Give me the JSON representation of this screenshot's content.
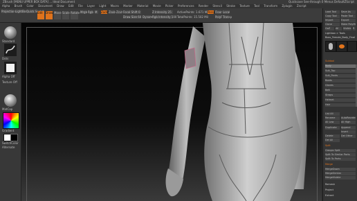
{
  "title_bar": {
    "text": "ZBrush  [MENU UPPER BOX DATA] ... Ideal Document",
    "right": "Quicksave   See-through 0   Menus   DefaultZScript"
  },
  "menu": [
    "Alpha",
    "Brush",
    "Color",
    "Document",
    "Draw",
    "Edit",
    "File",
    "Layer",
    "Light",
    "Macro",
    "Marker",
    "Material",
    "Movie",
    "Picker",
    "Preferences",
    "Render",
    "Stencil",
    "Stroke",
    "Texture",
    "Tool",
    "Transform",
    "Zplugin",
    "Zscript"
  ],
  "shelf": {
    "projection_master": "Projection Master",
    "lightbox": "LightBox",
    "quick_sketch": "Quick Sketch",
    "edit": "Edit",
    "draw": "Draw",
    "move": "Move",
    "scale": "Scale",
    "rotate": "Rotate",
    "mrgb": "Mrgb",
    "rgb": "Rgb",
    "m": "M",
    "zadd": "Zadd",
    "zsub": "Zsub",
    "zcut": "Zcut",
    "focal_shift": "Focal Shift 0",
    "draw_size": "Draw Size 64",
    "dynamic": "Dynamic",
    "z_intensity": "Z Intensity 25",
    "rgb_intensity": "Rgb Intensity 100",
    "active_points": "ActivePoints: 1.671 Mil",
    "total_points": "TotalPoints: 15.502 Mil",
    "persp": "Persp",
    "floor": "Floor",
    "polyframe": "PolyF",
    "local": "Local",
    "transp": "Transp"
  },
  "left_shelf": {
    "brush": "Standard",
    "stroke": "Dots",
    "alpha": "Alpha Off",
    "texture": "Texture Off",
    "material": "MatCap",
    "gradient": "Gradient",
    "switch_color": "SwitchColor",
    "alternate": "Alternate"
  },
  "right_tray": {
    "header": [
      "Load Tool",
      "Save As",
      "Copy Tool",
      "Paste Tool",
      "Import",
      "Export",
      "Clone",
      "Make PolyMesh3D",
      "GoZ",
      "All",
      "Visible",
      "R"
    ],
    "lightbox_tools": "Lightbox > Tools",
    "tool_name": "Boss_Female_Body_Final",
    "subtool": "Subtool",
    "subtools": [
      "Body",
      "Suit_Top",
      "Suit_Pants",
      "Boots",
      "Gloves",
      "Belt",
      "Straps",
      "Helmet",
      "Hair"
    ],
    "list_all": "List All",
    "rename": "Rename",
    "auto_reorder": "AutoReorder",
    "all_low": "All Low",
    "all_high": "All High",
    "duplicate": "Duplicate",
    "append": "Append",
    "insert": "Insert",
    "delete": "Delete",
    "del_other": "Del Other",
    "del_all": "Del All",
    "split": "Split",
    "groups_split": "Groups Split",
    "split_to_similar": "Split To Similar Parts",
    "split_to_parts": "Split To Parts",
    "merge": "Merge",
    "merge_down": "MergeDown",
    "merge_similar": "MergeSimilar",
    "merge_visible": "MergeVisible",
    "remesh": "Remesh",
    "project": "Project",
    "extract": "Extract"
  },
  "colors": {
    "accent": "#e0731c",
    "viewport_bg": "#0a0a0a",
    "panel": "#383838"
  }
}
